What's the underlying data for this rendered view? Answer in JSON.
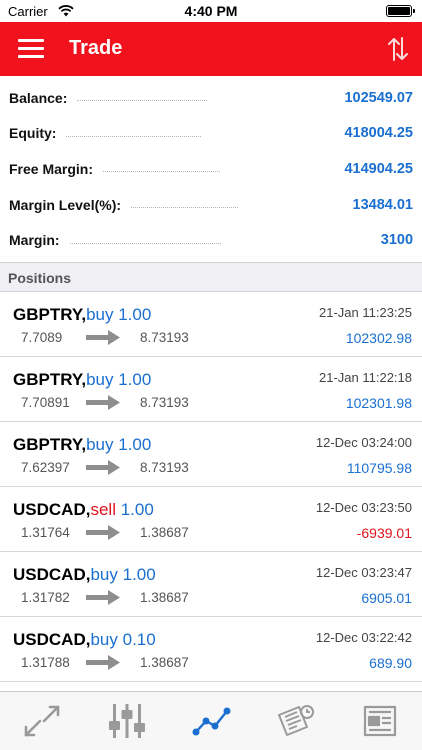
{
  "status": {
    "carrier": "Carrier",
    "time": "4:40 PM"
  },
  "header": {
    "title": "Trade"
  },
  "summary": [
    {
      "label": "Balance:",
      "value": "102549.07"
    },
    {
      "label": "Equity:",
      "value": "418004.25"
    },
    {
      "label": "Free Margin:",
      "value": "414904.25"
    },
    {
      "label": "Margin Level(%):",
      "value": "13484.01"
    },
    {
      "label": "Margin:",
      "value": "3100"
    }
  ],
  "positions_header": "Positions",
  "positions": [
    {
      "symbol": "GBPTRY",
      "sep": ",",
      "side": "buy",
      "lots": "1.00",
      "open": "7.7089",
      "current": "8.73193",
      "date": "21-Jan 11:23:25",
      "profit": "102302.98"
    },
    {
      "symbol": "GBPTRY",
      "sep": ",",
      "side": "buy",
      "lots": "1.00",
      "open": "7.70891",
      "current": "8.73193",
      "date": "21-Jan 11:22:18",
      "profit": "102301.98"
    },
    {
      "symbol": "GBPTRY",
      "sep": ",",
      "side": "buy",
      "lots": "1.00",
      "open": "7.62397",
      "current": "8.73193",
      "date": "12-Dec 03:24:00",
      "profit": "110795.98"
    },
    {
      "symbol": "USDCAD",
      "sep": ",",
      "side": "sell",
      "lots": "1.00",
      "open": "1.31764",
      "current": "1.38687",
      "date": "12-Dec 03:23:50",
      "profit": "-6939.01"
    },
    {
      "symbol": "USDCAD",
      "sep": ",",
      "side": "buy",
      "lots": "1.00",
      "open": "1.31782",
      "current": "1.38687",
      "date": "12-Dec 03:23:47",
      "profit": "6905.01"
    },
    {
      "symbol": "USDCAD",
      "sep": ",",
      "side": "buy",
      "lots": "0.10",
      "open": "1.31788",
      "current": "1.38687",
      "date": "12-Dec 03:22:42",
      "profit": "689.90"
    }
  ],
  "tabs": [
    {
      "icon": "quotes-icon"
    },
    {
      "icon": "chart-settings-icon"
    },
    {
      "icon": "trade-icon"
    },
    {
      "icon": "history-icon"
    },
    {
      "icon": "news-icon"
    }
  ],
  "colors": {
    "accent": "#f0131d",
    "positive": "#1a6fd0",
    "negative": "#e0141e",
    "active_tab": "#1a6fd0",
    "inactive_tab": "#9a9a9a"
  }
}
